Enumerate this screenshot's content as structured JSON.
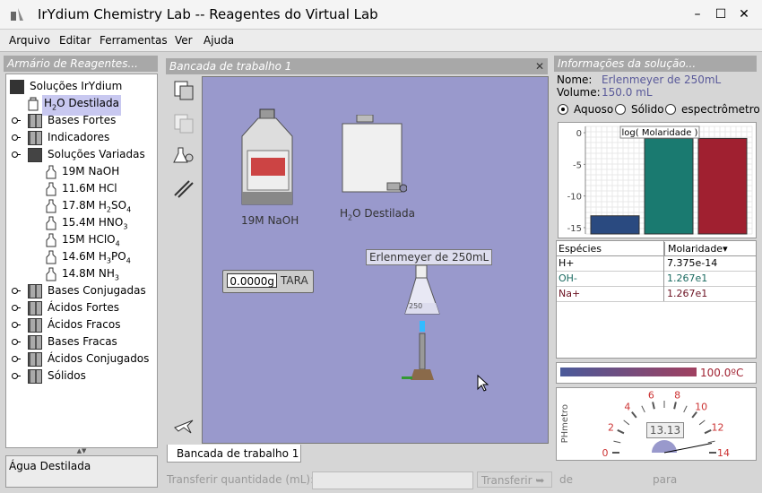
{
  "window": {
    "title": "IrYdium Chemistry Lab -- Reagentes do Virtual Lab"
  },
  "menu": [
    "Arquivo",
    "Editar",
    "Ferramentas",
    "Ver",
    "Ajuda"
  ],
  "cabinet": {
    "title": "Armário de Reagentes...",
    "root": "Soluções IrYdium",
    "selected": "H2O Destilada",
    "groups": [
      "Bases Fortes",
      "Indicadores",
      "Soluções Variadas"
    ],
    "solutions": [
      "19M NaOH",
      "11.6M HCl",
      "17.8M H2SO4",
      "15.4M HNO3",
      "15M HClO4",
      "14.6M H3PO4",
      "14.8M NH3"
    ],
    "groups2": [
      "Bases Conjugadas",
      "Ácidos Fortes",
      "Ácidos Fracos",
      "Bases Fracas",
      "Ácidos Conjugados",
      "Sólidos"
    ],
    "status": "Água Destilada"
  },
  "workbench": {
    "title": "Bancada de trabalho 1",
    "tab": "Bancada de trabalho 1",
    "bottle_label": "19M NaOH",
    "carboy_label": "H2O Destilada",
    "scale_value": "0.0000g",
    "scale_tare": "TARA",
    "flask_label": "Erlenmeyer de 250mL",
    "flask_marking": "250"
  },
  "info": {
    "title": "Informações da solução...",
    "name_label": "Nome:",
    "name_value": "Erlenmeyer de 250mL",
    "volume_label": "Volume:",
    "volume_value": "150.0 mL",
    "view_options": [
      "Aquoso",
      "Sólido",
      "espectrômetro"
    ],
    "selected_view": "Aquoso"
  },
  "chart_data": {
    "type": "bar",
    "title": "log( Molaridade )",
    "y_ticks": [
      "0",
      "-5",
      "-10",
      "-15"
    ],
    "ylim": [
      -16,
      1
    ],
    "series": [
      {
        "values": [
          -13.13
        ],
        "color": "#2a4a80"
      },
      {
        "values": [
          -0.9
        ],
        "color": "#1a7a70"
      },
      {
        "values": [
          -0.9
        ],
        "color": "#a02030"
      }
    ]
  },
  "species_table": {
    "headers": [
      "Espécies",
      "Molaridade"
    ],
    "rows": [
      {
        "species": "H+",
        "molarity": "7.375e-14",
        "color": "#000000"
      },
      {
        "species": "OH-",
        "molarity": "1.267e1",
        "color": "#1a6a60"
      },
      {
        "species": "Na+",
        "molarity": "1.267e1",
        "color": "#6a1020"
      }
    ]
  },
  "thermometer": {
    "value": "100.0ºC"
  },
  "ph_meter": {
    "label": "PHmetro",
    "value": "13.13",
    "scale": [
      "0",
      "2",
      "4",
      "6",
      "8",
      "10",
      "12",
      "14"
    ],
    "reading": 13.13
  },
  "transfer": {
    "label": "Transferir quantidade (mL):",
    "button": "Transferir",
    "from_label": "de",
    "to_label": "para"
  },
  "colors": {
    "workbench": "#9999cc",
    "panel_header": "#a8a8a8"
  }
}
